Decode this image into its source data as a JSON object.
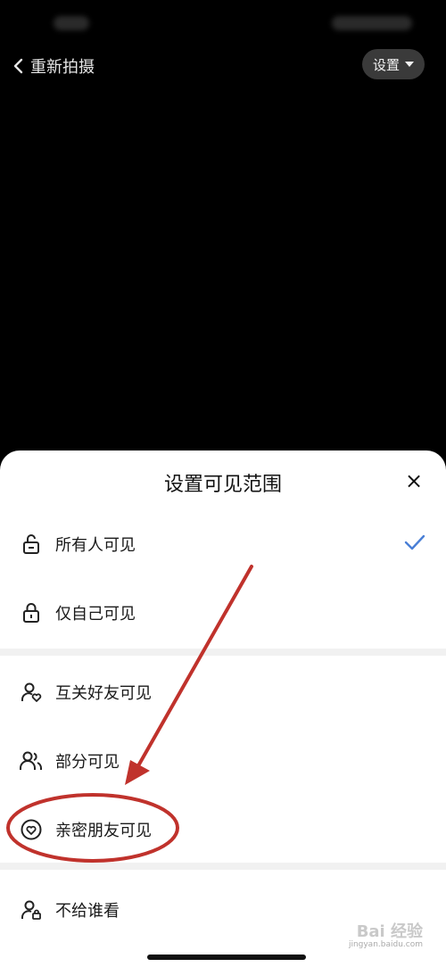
{
  "top_bar": {
    "back_label": "重新拍摄",
    "settings_label": "设置"
  },
  "sheet": {
    "title": "设置可见范围",
    "close_symbol": "×",
    "options": [
      {
        "label": "所有人可见",
        "icon": "lock-open-icon",
        "selected": true
      },
      {
        "label": "仅自己可见",
        "icon": "lock-icon",
        "selected": false
      },
      {
        "label": "互关好友可见",
        "icon": "person-heart-icon",
        "selected": false
      },
      {
        "label": "部分可见",
        "icon": "people-icon",
        "selected": false
      },
      {
        "label": "亲密朋友可见",
        "icon": "heart-circle-icon",
        "selected": false
      },
      {
        "label": "不给谁看",
        "icon": "person-lock-icon",
        "selected": false
      }
    ]
  },
  "watermark": {
    "brand": "Bai 经验",
    "url": "jingyan.baidu.com"
  },
  "colors": {
    "background": "#000000",
    "sheet": "#ffffff",
    "check": "#4a7fd6",
    "annotation": "#c0322c"
  }
}
